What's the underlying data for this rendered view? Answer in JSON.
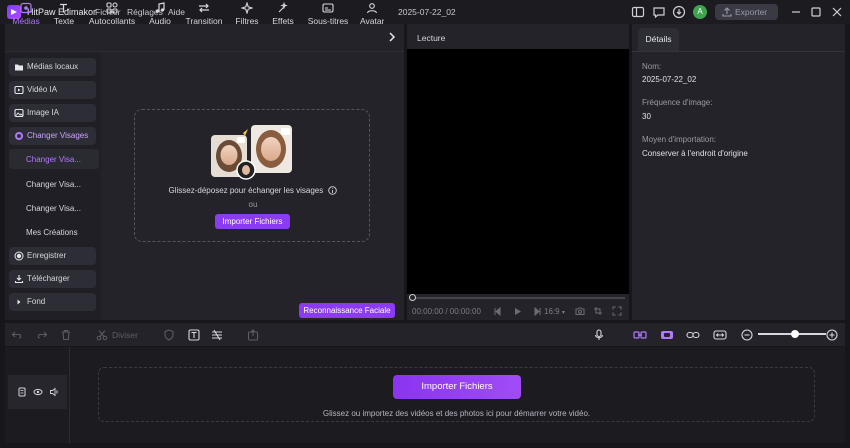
{
  "app": {
    "title": "HitPaw Edimakor",
    "menu": [
      "Fichier",
      "Réglages",
      "Aide"
    ],
    "project_name": "2025-07-22_02",
    "avatar_letter": "A",
    "export_label": "Exporter",
    "accent": "#8b3cf2"
  },
  "toolbar": {
    "tabs": [
      {
        "label": "Médias",
        "icon": "media-icon"
      },
      {
        "label": "Texte",
        "icon": "text-icon"
      },
      {
        "label": "Autocollants",
        "icon": "sticker-icon"
      },
      {
        "label": "Audio",
        "icon": "music-note-icon"
      },
      {
        "label": "Transition",
        "icon": "transition-icon"
      },
      {
        "label": "Filtres",
        "icon": "sparkle-icon"
      },
      {
        "label": "Effets",
        "icon": "effects-icon"
      },
      {
        "label": "Sous-titres",
        "icon": "subtitles-icon"
      },
      {
        "label": "Avatar",
        "icon": "avatar-icon"
      }
    ],
    "active": "Médias"
  },
  "sidebar": {
    "items": [
      {
        "label": "Médias locaux",
        "icon": "folder-icon"
      },
      {
        "label": "Vidéo IA",
        "icon": "video-icon"
      },
      {
        "label": "Image IA",
        "icon": "image-icon"
      },
      {
        "label": "Changer Visages",
        "icon": "face-swap-icon"
      }
    ],
    "subitems": [
      "Changer Visa...",
      "Changer Visa...",
      "Changer Visa...",
      "Mes Créations"
    ],
    "bottom_items": [
      {
        "label": "Enregistrer",
        "icon": "record-icon"
      },
      {
        "label": "Télécharger",
        "icon": "download-icon"
      },
      {
        "label": "Fond",
        "icon": "caret-right-icon"
      }
    ]
  },
  "media": {
    "drop_text": "Glissez-déposez pour échanger les visages",
    "or_text": "ou",
    "import_label": "Importer Fichiers",
    "facial_button": "Reconnaissance Faciale"
  },
  "preview": {
    "title": "Lecture",
    "timecode": "00:00:00 / 00:00:00",
    "ratio": "16:9"
  },
  "details": {
    "tab": "Détails",
    "fields": [
      {
        "label": "Nom:",
        "value": "2025-07-22_02"
      },
      {
        "label": "Fréquence d'image:",
        "value": "30"
      },
      {
        "label": "Moyen d'importation:",
        "value": "Conserver à l'endroit d'origine"
      }
    ]
  },
  "timeline": {
    "split_label": "Diviser",
    "zoom_level": 0.55,
    "import_label": "Importer Fichiers",
    "hint": "Glissez ou importez des vidéos et des photos ici pour démarrer votre vidéo."
  }
}
